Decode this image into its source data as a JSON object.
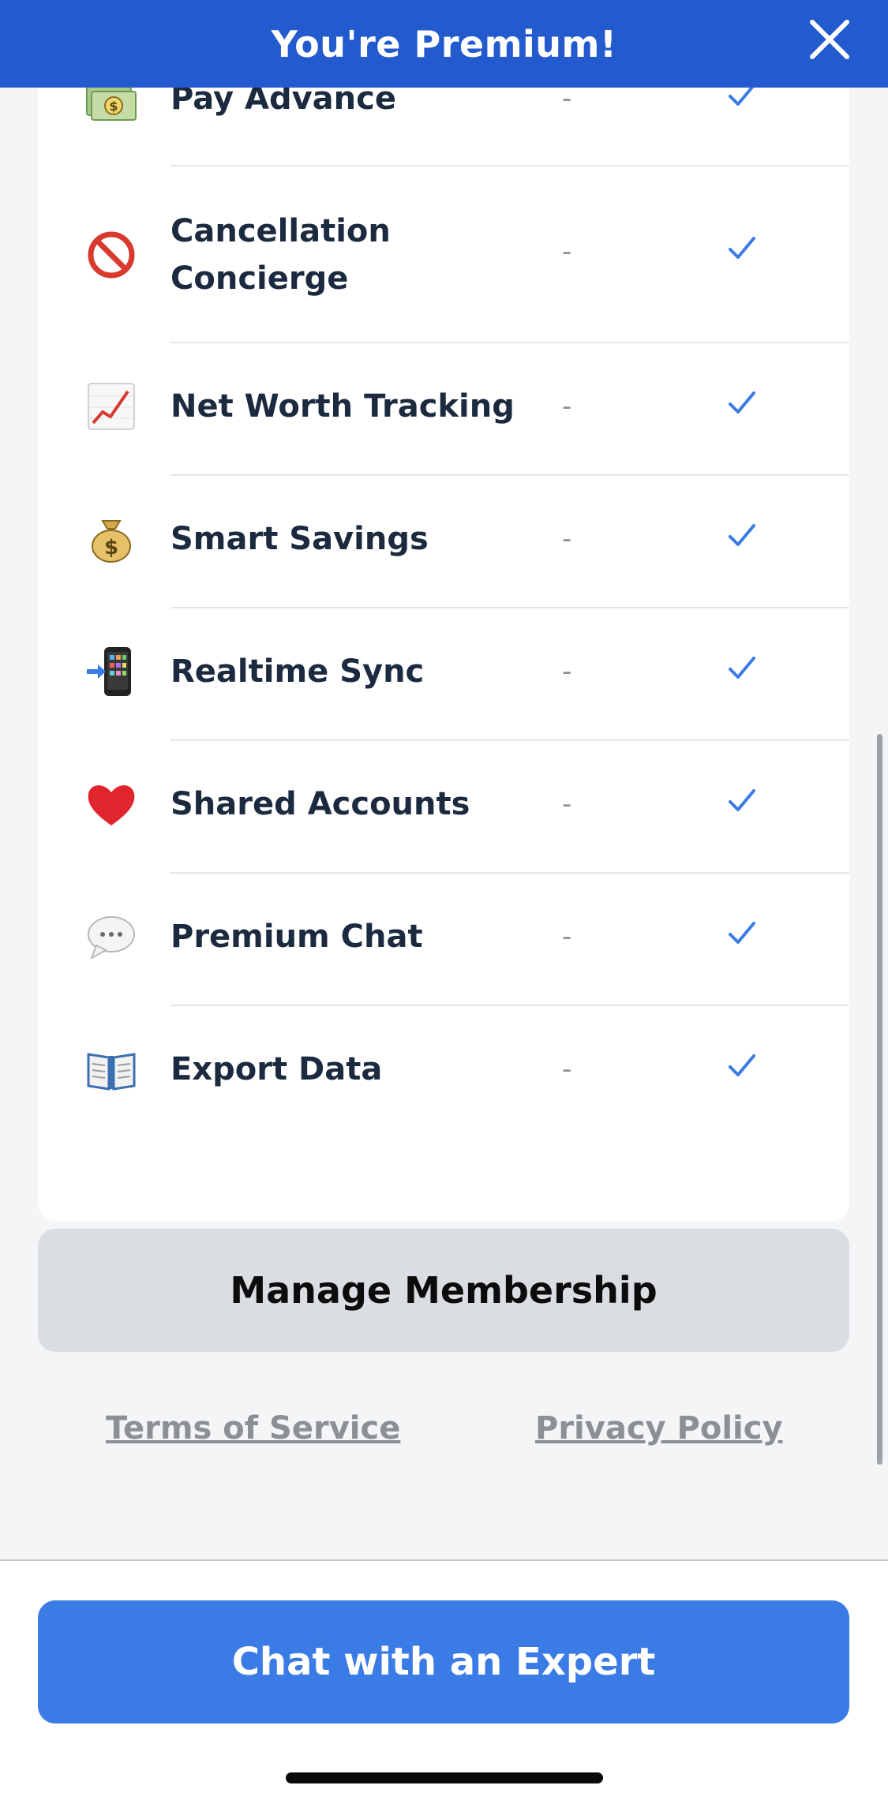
{
  "header": {
    "title": "You're Premium!"
  },
  "features": [
    {
      "icon": "money-bills-icon",
      "label": "Pay Advance",
      "basic": "-",
      "premium": "check"
    },
    {
      "icon": "no-entry-icon",
      "label": "Cancellation Concierge",
      "basic": "-",
      "premium": "check"
    },
    {
      "icon": "chart-up-icon",
      "label": "Net Worth Tracking",
      "basic": "-",
      "premium": "check"
    },
    {
      "icon": "money-bag-icon",
      "label": "Smart Savings",
      "basic": "-",
      "premium": "check"
    },
    {
      "icon": "phone-sync-icon",
      "label": "Realtime Sync",
      "basic": "-",
      "premium": "check"
    },
    {
      "icon": "heart-icon",
      "label": "Shared Accounts",
      "basic": "-",
      "premium": "check"
    },
    {
      "icon": "speech-bubble-icon",
      "label": "Premium Chat",
      "basic": "-",
      "premium": "check"
    },
    {
      "icon": "open-book-icon",
      "label": "Export Data",
      "basic": "-",
      "premium": "check"
    }
  ],
  "manage": {
    "label": "Manage Membership"
  },
  "links": {
    "terms": "Terms of Service",
    "privacy": "Privacy Policy"
  },
  "cta": {
    "label": "Chat with an Expert"
  },
  "colors": {
    "header": "#235bce",
    "accent": "#3a7be6",
    "check": "#3a7be6",
    "text": "#1c2a40"
  }
}
